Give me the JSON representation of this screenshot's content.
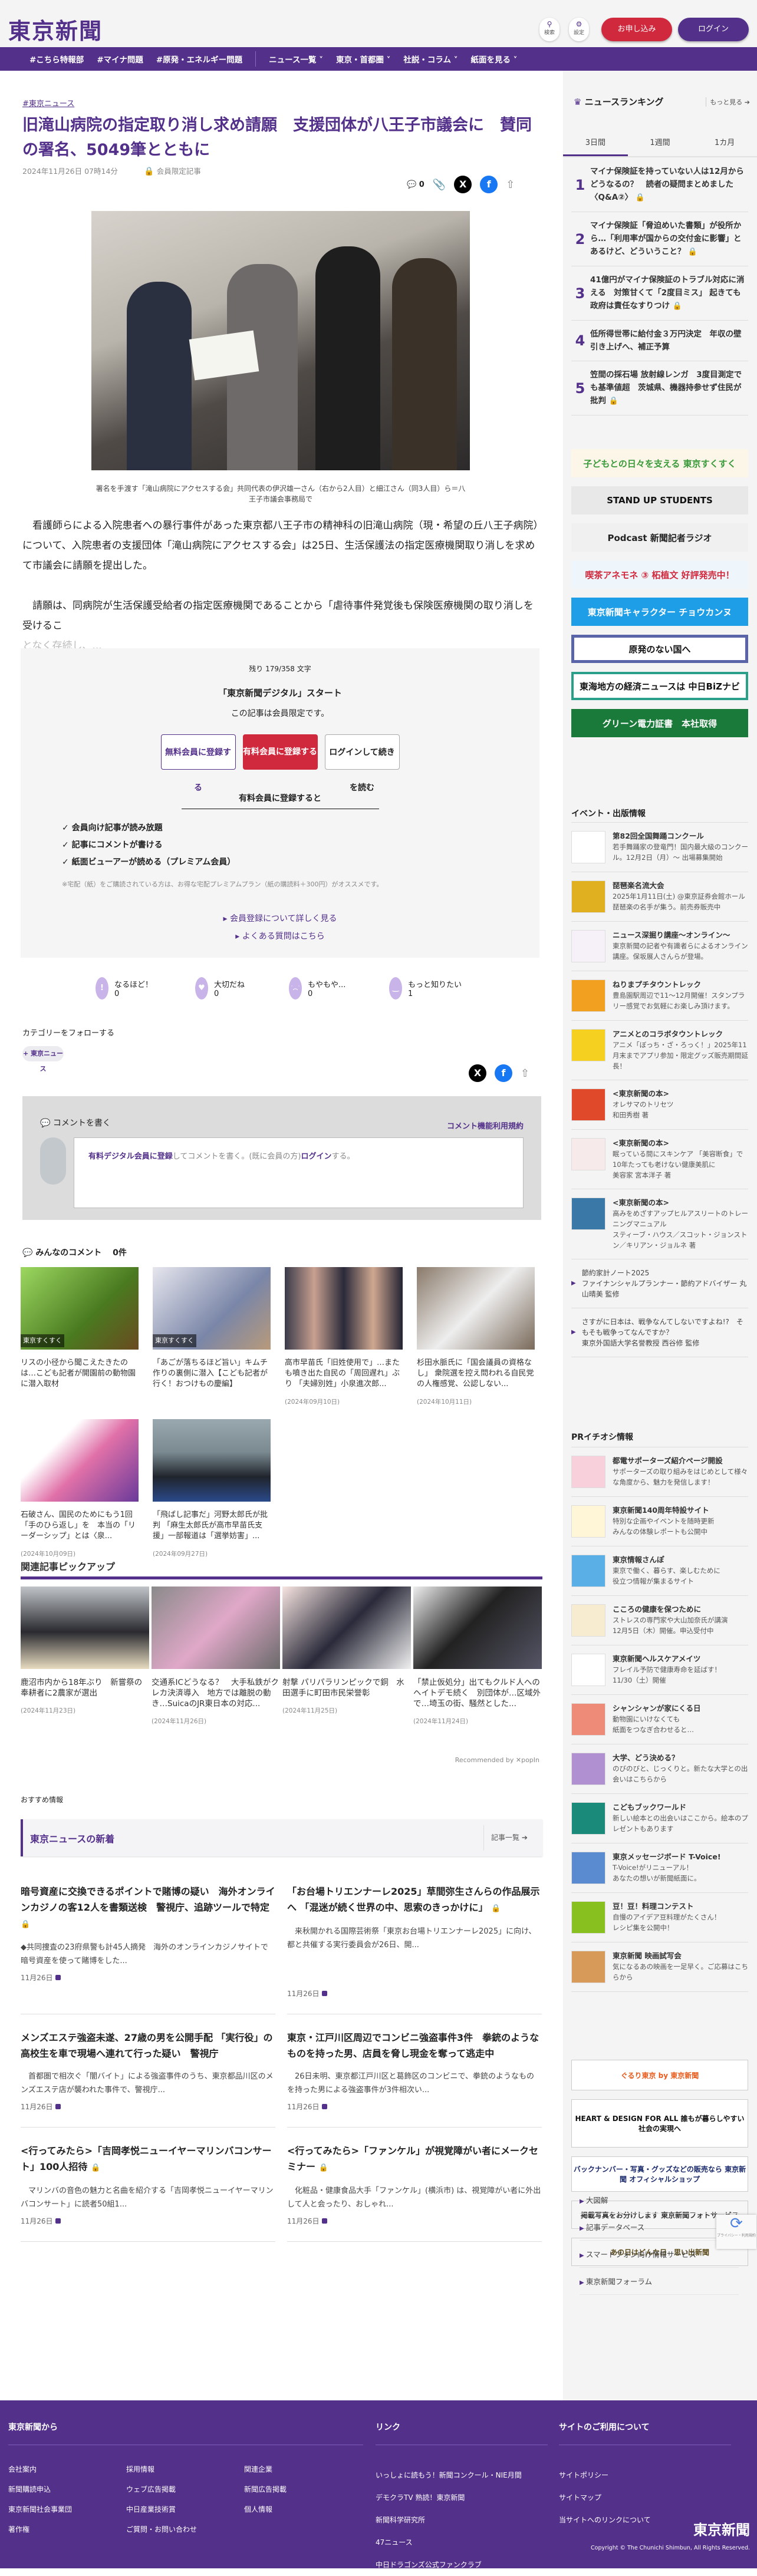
{
  "header": {
    "logo": "東京新聞",
    "search": "検索",
    "settings": "設定",
    "subscribe": "お申し込み",
    "login": "ログイン"
  },
  "nav": [
    "#こちら特報部",
    "#マイナ問題",
    "#原発・エネルギー問題",
    "ニュース一覧 ˅",
    "東京・首都圏 ˅",
    "社説・コラム ˅",
    "紙面を見る ˅"
  ],
  "article": {
    "tag": "#東京ニュース",
    "title": "旧滝山病院の指定取り消し求め請願　支援団体が八王子市議会に　賛同の署名、5049筆とともに",
    "date": "2024年11月26日 07時14分",
    "members_only": "会員限定記事",
    "comment_count": "0",
    "caption": "署名を手渡す「滝山病院にアクセスする会」共同代表の伊沢雄一さん（右から2人目）と細江さん（同3人目）ら＝八王子市議会事務局で",
    "para1": "看護師らによる入院患者への暴行事件があった東京都八王子市の精神科の旧滝山病院（現・希望の丘八王子病院）について、入院患者の支援団体「滝山病院にアクセスする会」は25日、生活保護法の指定医療機関取り消しを求めて市議会に請願を提出した。",
    "para2": "請願は、同病院が生活保護受給者の指定医療機関であることから「虐待事件発覚後も保険医療機関の取り消しを受けるこ",
    "para2_fade": "となく存続し、..."
  },
  "paywall": {
    "remaining": "残り 179/358 文字",
    "headline": "「東京新聞デジタル」スタート",
    "sub": "この記事は会員限定です。",
    "free": "無料会員に登録する",
    "paid": "有料会員に登録する",
    "login": "ログインして続きを読む",
    "benefit_title": "有料会員に登録すると",
    "benefits": [
      "✓ 会員向け記事が読み放題",
      "✓ 記事にコメントが書ける",
      "✓ 紙面ビューアーが読める（プレミアム会員）"
    ],
    "note": "※宅配（紙）をご購読されている方は、お得な宅配プレミアムプラン（紙の購読料＋300円）がオススメです。",
    "link1": "▸ 会員登録について詳しく見る",
    "link2": "▸ よくある質問はこちら"
  },
  "reactions": [
    {
      "label": "なるほど！",
      "count": "0",
      "icon": "!"
    },
    {
      "label": "大切だね",
      "count": "0",
      "icon": "♥"
    },
    {
      "label": "もやもや...",
      "count": "0",
      "icon": "˙︵˙"
    },
    {
      "label": "もっと知りたい",
      "count": "1",
      "icon": "‿"
    }
  ],
  "follow": {
    "label": "カテゴリーをフォローする",
    "chip": "+ 東京ニュース"
  },
  "comment": {
    "title": "コメントを書く",
    "rules": "コメント機能利用規約",
    "register": "有料デジタル会員に登録",
    "mid": "してコメントを書く。(既に会員の方)",
    "login": "ログイン",
    "end": "する。",
    "all": "みんなのコメント　 0件"
  },
  "thumbs": [
    {
      "title": "リスの小径から聞こえたきたのは…こども記者が開園前の動物園に潜入取材",
      "label": "東京すくすく",
      "date": ""
    },
    {
      "title": "「あごが落ちるほど旨い」キムチ作りの裏側に潜入【こども記者が行く！おつけもの慶編】",
      "label": "東京すくすく",
      "date": ""
    },
    {
      "title": "高市早苗氏「旧姓使用で」…またも噴き出た自民の「周回遅れ」ぶり 「夫婦別姓」小泉進次郎...",
      "label": "",
      "date": "(2024年09月10日)"
    },
    {
      "title": "杉田水脈氏に「国会議員の資格なし」 衆院選を控え問われる自民党の人権感覚、公認しない...",
      "label": "",
      "date": "(2024年10月11日)"
    },
    {
      "title": "石破さん、国民のためにもう1回「手のひら返し」を　本当の「リーダーシップ」とは〈泉...",
      "label": "",
      "date": "(2024年10月09日)"
    },
    {
      "title": "「飛ばし記事だ」河野太郎氏が批判 「麻生太郎氏が高市早苗氏支援」一部報道は「選挙妨害」...",
      "label": "",
      "date": "(2024年09月27日)"
    }
  ],
  "pickup": {
    "title": "関連記事ピックアップ",
    "items": [
      {
        "title": "鹿沼市内から18年ぶり　新嘗祭の奉耕者に2農家が選出",
        "date": "(2024年11月23日)"
      },
      {
        "title": "交通系ICどうなる？　大手私鉄がクレカ決済導入　地方では離脱の動き…SuicaのJR東日本の対応...",
        "date": "(2024年11月26日)"
      },
      {
        "title": "射撃 パリパラリンピックで銅　水田選手に町田市民栄誉彰",
        "date": "(2024年11月25日)"
      },
      {
        "title": "「禁止仮処分」出てもクルド人へのヘイトデモ続く　別団体が…区域外で…埼玉の街、騒然とした...",
        "date": "(2024年11月24日)"
      }
    ],
    "recommended": "Recommended by ✕popIn"
  },
  "osusume": "おすすめ情報",
  "latest": {
    "title": "東京ニュースの新着",
    "more": "記事一覧 ➔",
    "items": [
      {
        "title": "暗号資産に交換できるポイントで賭博の疑い　海外オンラインカジノの客12人を書類送検　警視庁、追跡ツールで特定",
        "desc": "◆共同捜査の23府県警も計45人摘発　海外のオンラインカジノサイトで暗号資産を使って賭博をした...",
        "date": "11月26日",
        "lock": "gray"
      },
      {
        "title": "「お台場トリエンナーレ2025」草間弥生さんらの作品展示へ 「混迷が続く世界の中、思索のきっかけに」",
        "desc": "　来秋開かれる国際芸術祭「東京お台場トリエンナーレ2025」に向け、都と共催する実行委員会が26日、開...",
        "date": "11月26日",
        "lock": "gold"
      },
      {
        "title": "メンズエステ強盗未遂、27歳の男を公開手配 「実行役」の高校生を車で現場へ連れて行った疑い　警視庁",
        "desc": "　首都圏で相次ぐ「闇バイト」による強盗事件のうち、東京都品川区のメンズエステ店が襲われた事件で、警視庁...",
        "date": "11月26日",
        "lock": ""
      },
      {
        "title": "東京・江戸川区周辺でコンビニ強盗事件3件　拳銃のようなものを持った男、店員を脅し現金を奪って逃走中",
        "desc": "　26日未明、東京都江戸川区と葛飾区のコンビニで、拳銃のようなものを持った男による強盗事件が3件相次い...",
        "date": "11月26日",
        "lock": ""
      },
      {
        "title": "<行ってみたら>「吉岡孝悦ニューイヤーマリンバコンサート」100人招待",
        "desc": "　マリンバの音色の魅力と名曲を紹介する「吉岡孝悦ニューイヤーマリンバコンサート」に読者50組1...",
        "date": "11月26日",
        "lock": "gray"
      },
      {
        "title": "<行ってみたら>「ファンケル」が視覚障がい者にメークセミナー",
        "desc": "　化粧品・健康食品大手「ファンケル」(横浜市) は、視覚障がい者に外出して人と会ったり、おしゃれ...",
        "date": "11月26日",
        "lock": "gray"
      }
    ]
  },
  "sidebar": {
    "ranking": {
      "title": "ニュースランキング",
      "more": "もっと見る ➔",
      "tabs": [
        "3日間",
        "1週間",
        "1カ月"
      ],
      "items": [
        {
          "n": "1",
          "title": "マイナ保険証を持っていない人は12月からどうなるの？　読者の疑問まとめました〈Q&A②〉",
          "lock": true
        },
        {
          "n": "2",
          "title": "マイナ保険証「脅迫めいた書類」が役所から…「利用率が国からの交付金に影響」とあるけど、どういうこと？",
          "lock": true
        },
        {
          "n": "3",
          "title": "41億円がマイナ保険証のトラブル対応に消える　対策甘くて「2度目ミス」 起きても政府は責任なすりつけ",
          "lock": true
        },
        {
          "n": "4",
          "title": "低所得世帯に給付金３万円決定　年収の壁引き上げへ、補正予算",
          "lock": false
        },
        {
          "n": "5",
          "title": "笠間の採石場 放射線レンガ　3度目測定でも基準値超　茨城県、機器持参せず住民が批判",
          "lock": true
        }
      ]
    },
    "banners": [
      "子どもとの日々を支える 東京すくすく",
      "STAND UP STUDENTS",
      "Podcast 新聞記者ラジオ",
      "喫茶アネモネ ③ 柘植文 好評発売中！",
      "東京新聞キャラクター チョウカンヌ",
      "原発のない国へ",
      "東海地方の経済ニュースは 中日BiZナビ",
      "グリーン電力証書　本社取得"
    ],
    "events_title": "イベント・出版情報",
    "events": [
      {
        "title": "第82回全国舞踊コンクール",
        "desc": "若手舞踊家の登竜門！国内最大級のコンクール。12月2日（月）～ 出場募集開始",
        "color": "#fff"
      },
      {
        "title": "琵琶楽名流大会",
        "desc": "2025年1月11日(土) @東京証券会館ホール　琵琶楽の名手が集う。前売券販売中",
        "color": "#e0b020"
      },
      {
        "title": "ニュース深掘り講座～オンライン～",
        "desc": "東京新聞の記者や有識者らによるオンライン講座。保坂展人さんらが登場。",
        "color": "#f6f0f8"
      },
      {
        "title": "ねりまプチタウントレック",
        "desc": "豊島園駅周辺で11～12月開催！スタンプラリー感覚でお気軽にお楽しみ頂けます。",
        "color": "#f2a020"
      },
      {
        "title": "アニメとのコラボタウントレック",
        "desc": "アニメ「ぼっち・ざ・ろっく！」2025年11月末までアプリ参加・限定グッズ販売期間延長！",
        "color": "#f5d020"
      },
      {
        "title": "<東京新聞の本>",
        "desc": "オレサマのトリセツ\n和田秀樹 著",
        "color": "#e04a2a"
      },
      {
        "title": "<東京新聞の本>",
        "desc": "眠っている間にスキンケア 「美容断食」で10年たっても老けない健康美肌に\n美容家 宮本洋子 著",
        "color": "#f6eaea"
      },
      {
        "title": "<東京新聞の本>",
        "desc": "高みをめざすアップヒルアスリートのトレーニングマニュアル\nスティーブ・ハウス／スコット・ジョンストン／キリアン・ジョルネ 著",
        "color": "#3a78a8"
      }
    ],
    "books": [
      "節約家計ノート2025\nファイナンシャルプランナー・節約アドバイザー 丸山晴美 監修",
      "さすがに日本は、戦争なんてしないですよね!?　そもそも戦争ってなんですか？\n東京外国語大学名誉教授 西谷修 監修"
    ],
    "pr_title": "PRイチオシ情報",
    "pr": [
      {
        "title": "都電サポーターズ紹介ページ開設",
        "desc": "サポーターズの取り組みをはじめとして様々な角度から、魅力を発信します！",
        "color": "#f7d0dc"
      },
      {
        "title": "東京新聞140周年特設サイト",
        "desc": "特別な企画やイベントを随時更新\nみんなの体験レポートも公開中",
        "color": "#fff6d8"
      },
      {
        "title": "東京情報さんぽ",
        "desc": "東京で働く、暮らす、楽しむために\n役立つ情報が集まるサイト",
        "color": "#5ab0e6"
      },
      {
        "title": "こころの健康を保つために",
        "desc": "ストレスの専門家や大山加奈氏が講演\n12月5日（木）開催。申込受付中",
        "color": "#f8ecd0"
      },
      {
        "title": "東京新聞ヘルスケアメイツ",
        "desc": "フレイル予防で健康寿命を延ばす！\n11/30（土）開催",
        "color": "#fff"
      },
      {
        "title": "シャンシャンが家にくる日",
        "desc": "動物園にいけなくても\n紙面をつなぎ合わせると…",
        "color": "#ee8a78"
      },
      {
        "title": "大学、どう決める？",
        "desc": "のびのびと、じっくりと。新たな大学との出会いはこちらから",
        "color": "#b090d0"
      },
      {
        "title": "こどもブックワールド",
        "desc": "新しい絵本との出会いはここから。絵本のプレゼントもあります",
        "color": "#1a8a7a"
      },
      {
        "title": "東京メッセージボード T-Voice!",
        "desc": "T-Voice!がリニューアル！\nあなたの想いが新聞紙面に。",
        "color": "#5a8ad0"
      },
      {
        "title": "豆！豆！料理コンテスト",
        "desc": "自慢のアイデア豆料理がたくさん！\nレシピ集を公開中！",
        "color": "#88c020"
      },
      {
        "title": "東京新聞 映画試写会",
        "desc": "気になるあの映画を一足早く。ご応募はこちらから",
        "color": "#d89a58"
      }
    ],
    "banners2": [
      "ぐるり東京 by 東京新聞",
      "HEART & DESIGN FOR ALL 誰もが暮らしやすい社会の実現へ",
      "バックナンバー・写真・グッズなどの販売なら 東京新聞 オフィシャルショップ",
      "掲載写真をお分けします 東京新聞フォトサービス",
      "あの日はどんな日　思い出新聞"
    ],
    "links": [
      "大図解",
      "記事データベース",
      "スマートフォン向け情報サービス",
      "東京新聞フォーラム"
    ],
    "recaptcha": "プライバシー・利用規約"
  },
  "footer": {
    "col1_title": "東京新聞から",
    "col1": [
      "会社案内",
      "採用情報",
      "関連企業",
      "新聞購読申込",
      "ウェブ広告掲載",
      "新聞広告掲載",
      "東京新聞社会事業団",
      "中日産業技術賞",
      "個人情報",
      "著作権",
      "ご質問・お問い合わせ"
    ],
    "col2_title": "リンク",
    "col2": [
      "いっしょに読もう！新聞コンクール・NIE月間",
      "デモクラTV 熟読！東京新聞",
      "新聞科学研究所",
      "47ニュース",
      "中日ドラゴンズ公式ファンクラブ"
    ],
    "col3_title": "サイトのご利用について",
    "col3": [
      "サイトポリシー",
      "サイトマップ",
      "当サイトへのリンクについて"
    ],
    "logo": "東京新聞",
    "copyright": "Copyright © The Chunichi Shimbun, All Rights Reserved."
  },
  "colors": {
    "brand": "#53308a",
    "red": "#d0283c"
  }
}
